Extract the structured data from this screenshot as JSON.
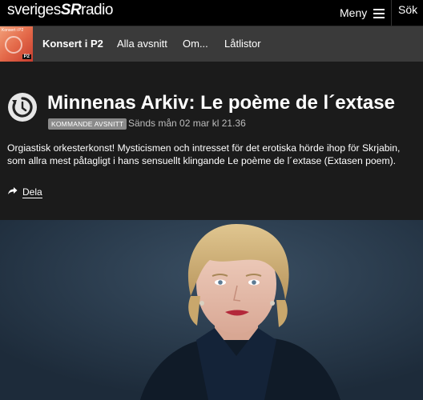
{
  "header": {
    "logo_text_a": "sveriges",
    "logo_text_b": "radio",
    "menu_label": "Meny",
    "search_label": "Sök"
  },
  "program": {
    "tabs": [
      {
        "label": "Konsert i P2"
      },
      {
        "label": "Alla avsnitt"
      },
      {
        "label": "Om..."
      },
      {
        "label": "Låtlistor"
      }
    ],
    "thumb_label": "Konsert i P2",
    "thumb_badge": "P2"
  },
  "episode": {
    "title": "Minnenas Arkiv: Le poème de l´extase",
    "tag": "KOMMANDE AVSNITT",
    "airtime": "Sänds mån 02 mar kl 21.36",
    "description": "Orgiastisk orkesterkonst! Mysticismen och intresset för det erotiska hörde ihop för Skrjabin, som allra mest påtagligt i hans sensuellt klingande Le poème de l´extase (Extasen poem).",
    "share_label": "Dela"
  },
  "colors": {
    "page_bg": "#1b1b1b",
    "topbar_bg": "#000000",
    "nav_bg": "#3a3a3a",
    "tag_bg": "#8a8a8a"
  },
  "icons": [
    "hamburger-icon",
    "replay-icon",
    "share-arrow-icon"
  ]
}
